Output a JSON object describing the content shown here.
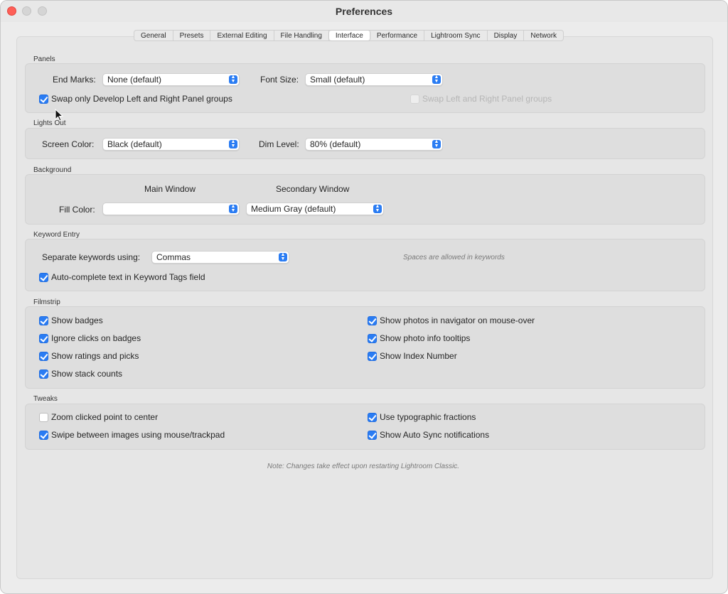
{
  "window": {
    "title": "Preferences"
  },
  "tabs": [
    "General",
    "Presets",
    "External Editing",
    "File Handling",
    "Interface",
    "Performance",
    "Lightroom Sync",
    "Display",
    "Network"
  ],
  "panels": {
    "title": "Panels",
    "end_marks_label": "End Marks:",
    "end_marks_value": "None (default)",
    "font_size_label": "Font Size:",
    "font_size_value": "Small (default)",
    "swap_develop_label": "Swap only Develop Left and Right Panel groups",
    "swap_left_right_label": "Swap Left and Right Panel groups"
  },
  "lights_out": {
    "title": "Lights Out",
    "screen_color_label": "Screen Color:",
    "screen_color_value": "Black (default)",
    "dim_level_label": "Dim Level:",
    "dim_level_value": "80% (default)"
  },
  "background": {
    "title": "Background",
    "main_window_label": "Main Window",
    "secondary_window_label": "Secondary Window",
    "fill_color_label": "Fill Color:",
    "main_fill_value": "",
    "secondary_fill_value": "Medium Gray (default)"
  },
  "keyword_entry": {
    "title": "Keyword Entry",
    "separate_label": "Separate keywords using:",
    "separate_value": "Commas",
    "spaces_hint": "Spaces are allowed in keywords",
    "autocomplete_label": "Auto-complete text in Keyword Tags field"
  },
  "filmstrip": {
    "title": "Filmstrip",
    "left": [
      "Show badges",
      "Ignore clicks on badges",
      "Show ratings and picks",
      "Show stack counts"
    ],
    "right": [
      "Show photos in navigator on mouse-over",
      "Show photo info tooltips",
      "Show Index Number"
    ]
  },
  "tweaks": {
    "title": "Tweaks",
    "zoom_label": "Zoom clicked point to center",
    "swipe_label": "Swipe between images using mouse/trackpad",
    "typographic_label": "Use typographic fractions",
    "autosync_label": "Show Auto Sync notifications"
  },
  "note": "Note: Changes take effect upon restarting Lightroom Classic.",
  "colors": {
    "accent": "#2a7cf3",
    "close": "#fe5f57"
  }
}
